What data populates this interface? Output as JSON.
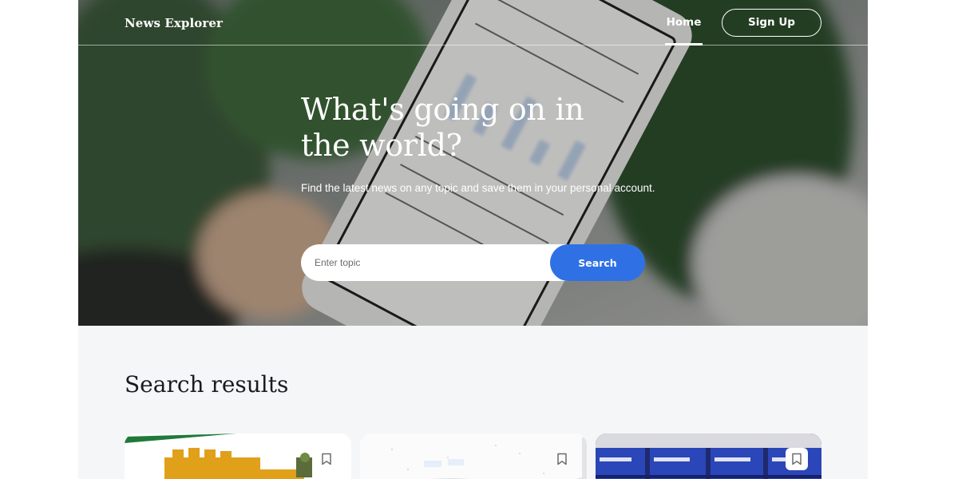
{
  "header": {
    "logo": "News Explorer",
    "nav_home": "Home",
    "nav_signup": "Sign Up"
  },
  "hero": {
    "title": "What's going on in the world?",
    "subtitle": "Find the latest news on any topic and save them in your personal account."
  },
  "search": {
    "placeholder": "Enter topic",
    "button_label": "Search"
  },
  "results": {
    "title": "Search results",
    "cards": [
      {
        "image": "lego-great-wall-photo",
        "bookmark_icon": "bookmark-icon"
      },
      {
        "image": "map-screenshot",
        "bookmark_icon": "bookmark-icon"
      },
      {
        "image": "stacked-cases-photo",
        "bookmark_icon": "bookmark-icon"
      }
    ]
  },
  "colors": {
    "accent": "#2f71e5",
    "page_bg": "#f5f6f7",
    "text_dark": "#1a1b22"
  }
}
